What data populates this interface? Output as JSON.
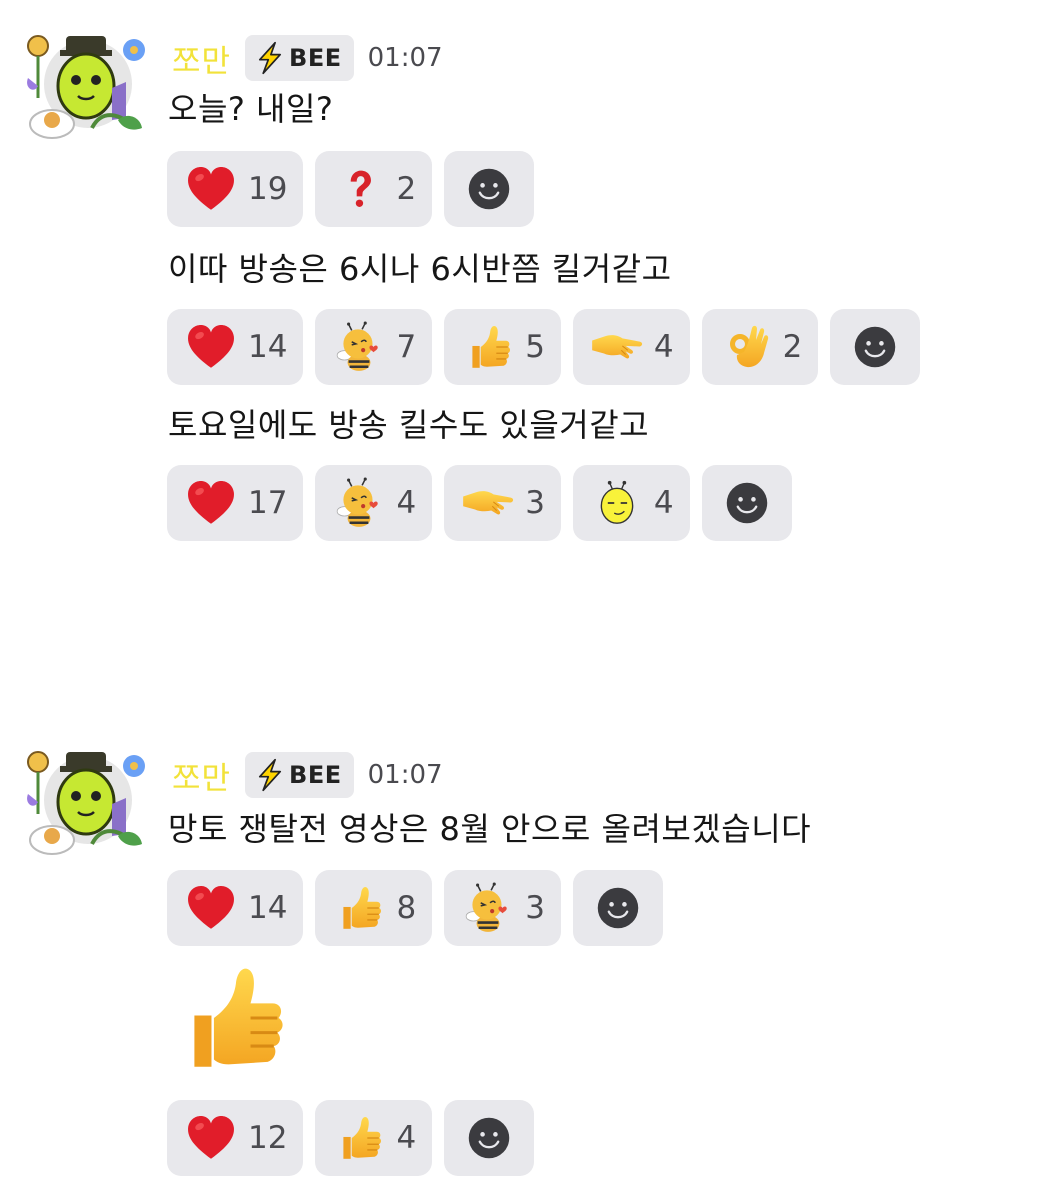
{
  "messages": [
    {
      "author": "쪼만",
      "badge": "BEE",
      "time": "01:07",
      "lines": [
        {
          "text": "오늘? 내일?",
          "reactions": [
            {
              "icon": "heart-icon",
              "count": "19"
            },
            {
              "icon": "question-icon",
              "count": "2"
            }
          ]
        },
        {
          "text": "이따 방송은 6시나 6시반쯤 킬거같고",
          "reactions": [
            {
              "icon": "heart-icon",
              "count": "14"
            },
            {
              "icon": "bee-kiss-icon",
              "count": "7"
            },
            {
              "icon": "thumbs-up-icon",
              "count": "5"
            },
            {
              "icon": "pointing-hand-icon",
              "count": "4"
            },
            {
              "icon": "ok-hand-icon",
              "count": "2"
            }
          ]
        },
        {
          "text": "토요일에도 방송 킬수도 있을거같고",
          "reactions": [
            {
              "icon": "heart-icon",
              "count": "17"
            },
            {
              "icon": "bee-kiss-icon",
              "count": "4"
            },
            {
              "icon": "pointing-hand-icon",
              "count": "3"
            },
            {
              "icon": "bee-smirk-icon",
              "count": "4"
            }
          ]
        }
      ]
    },
    {
      "author": "쪼만",
      "badge": "BEE",
      "time": "01:07",
      "lines": [
        {
          "text": "망토 쟁탈전 영상은 8월 안으로 올려보겠습니다",
          "reactions": [
            {
              "icon": "heart-icon",
              "count": "14"
            },
            {
              "icon": "thumbs-up-icon",
              "count": "8"
            },
            {
              "icon": "bee-kiss-icon",
              "count": "3"
            }
          ]
        },
        {
          "big_emoji": "thumbs-up-icon",
          "reactions": [
            {
              "icon": "heart-icon",
              "count": "12"
            },
            {
              "icon": "thumbs-up-icon",
              "count": "4"
            }
          ]
        }
      ]
    }
  ],
  "colors": {
    "username": "#f2e23a",
    "chip_background": "#e8e8ec",
    "count_text": "#4b4b50"
  }
}
